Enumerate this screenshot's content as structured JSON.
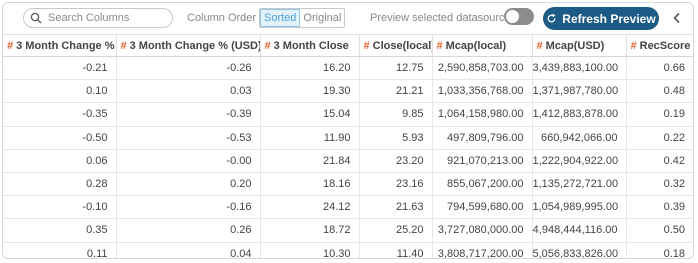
{
  "toolbar": {
    "search_placeholder": "Search Columns",
    "column_order_label": "Column Order",
    "sorted_label": "Sorted",
    "original_label": "Original",
    "preview_label": "Preview selected datasource",
    "preview_toggle_on": false,
    "refresh_label": "Refresh Preview",
    "accent_color": "#1c5b86",
    "type_icon_color": "#e8612c"
  },
  "table": {
    "columns": [
      "3 Month Change %",
      "3 Month Change % (USD)",
      "3 Month Close",
      "Close(local)",
      "Mcap(local)",
      "Mcap(USD)",
      "RecScore"
    ],
    "rows": [
      [
        "-0.21",
        "-0.26",
        "16.20",
        "12.75",
        "2,590,858,703.00",
        "3,439,883,100.00",
        "0.66"
      ],
      [
        "0.10",
        "0.03",
        "19.30",
        "21.21",
        "1,033,356,768.00",
        "1,371,987,780.00",
        "0.48"
      ],
      [
        "-0.35",
        "-0.39",
        "15.04",
        "9.85",
        "1,064,158,980.00",
        "1,412,883,878.00",
        "0.19"
      ],
      [
        "-0.50",
        "-0.53",
        "11.90",
        "5.93",
        "497,809,796.00",
        "660,942,066.00",
        "0.22"
      ],
      [
        "0.06",
        "-0.00",
        "21.84",
        "23.20",
        "921,070,213.00",
        "1,222,904,922.00",
        "0.42"
      ],
      [
        "0.28",
        "0.20",
        "18.16",
        "23.16",
        "855,067,200.00",
        "1,135,272,721.00",
        "0.32"
      ],
      [
        "-0.10",
        "-0.16",
        "24.12",
        "21.63",
        "794,599,680.00",
        "1,054,989,995.00",
        "0.39"
      ],
      [
        "0.35",
        "0.26",
        "18.72",
        "25.20",
        "3,727,080,000.00",
        "4,948,444,116.00",
        "0.50"
      ],
      [
        "0.11",
        "0.04",
        "10.30",
        "11.40",
        "3,808,717,200.00",
        "5,056,833,826.00",
        "0.18"
      ]
    ]
  }
}
